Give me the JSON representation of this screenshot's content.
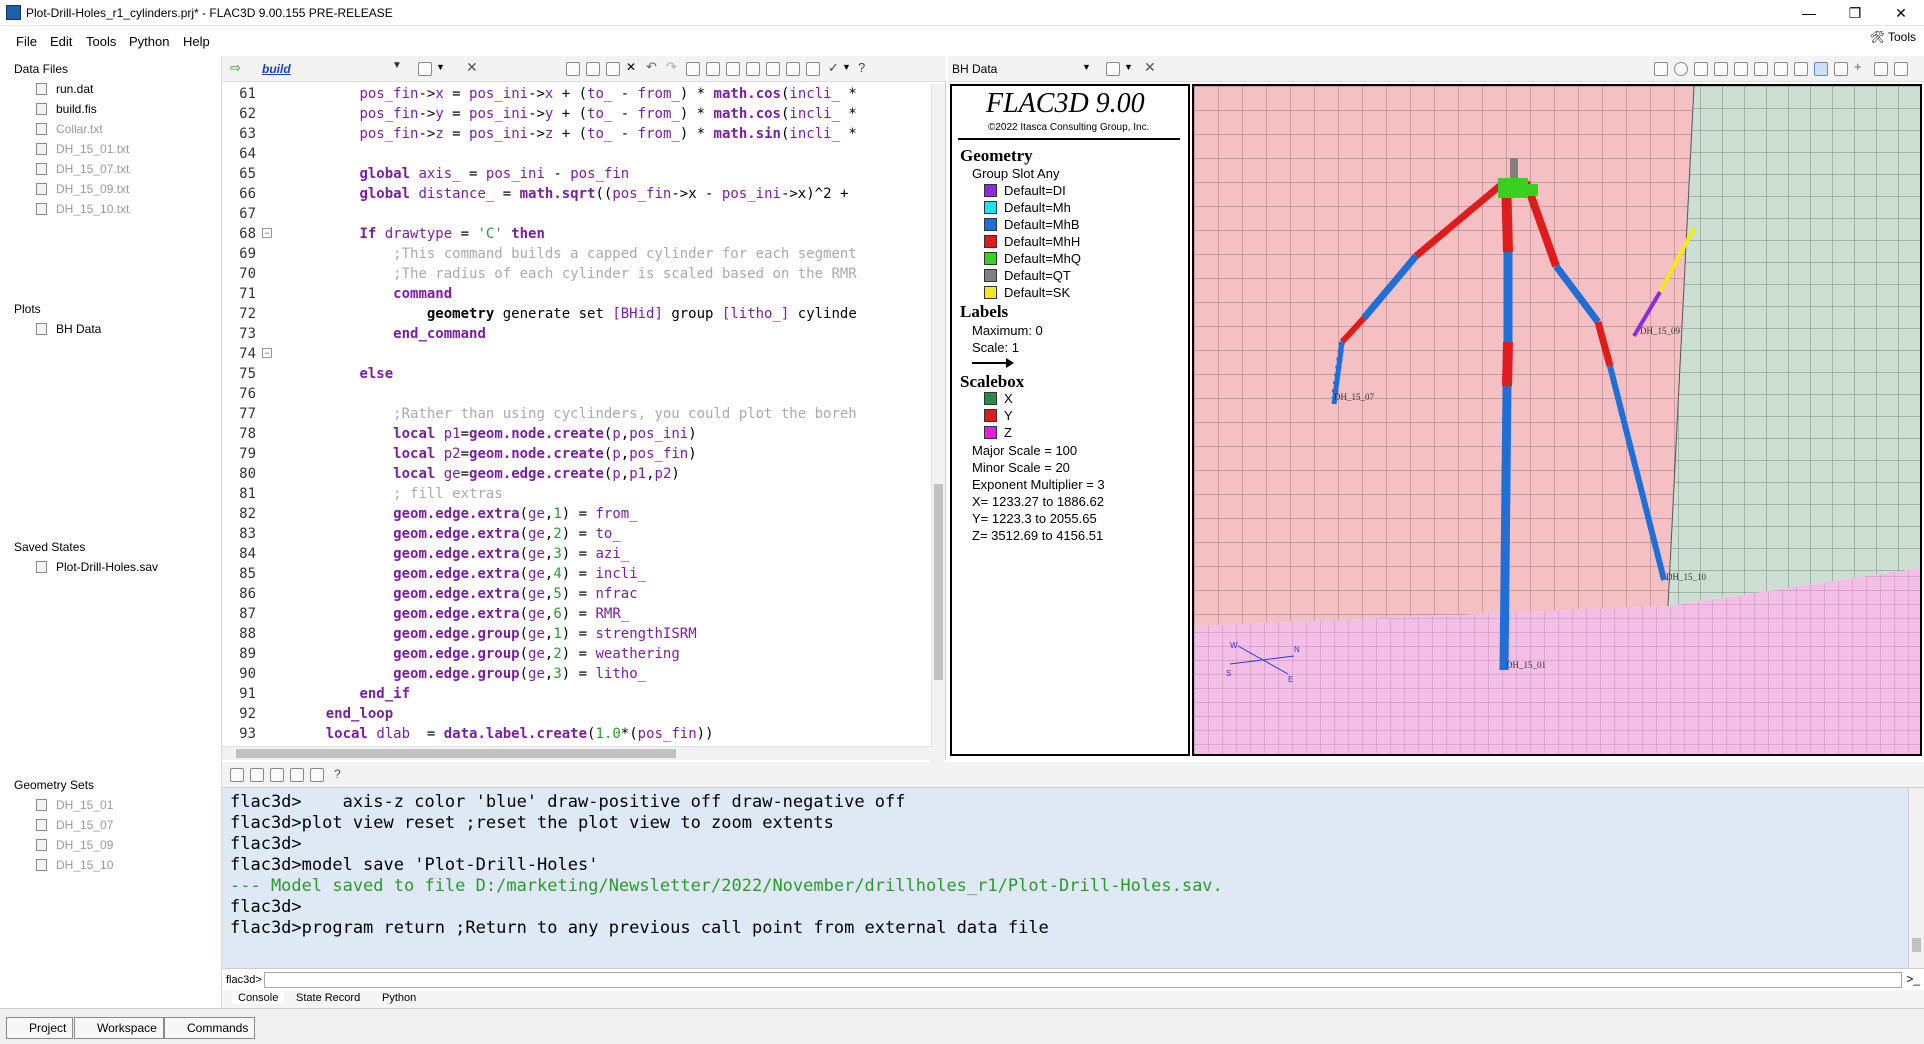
{
  "window": {
    "title": "Plot-Drill-Holes_r1_cylinders.prj* - FLAC3D 9.00.155 PRE-RELEASE",
    "minimize": "—",
    "maximize": "❐",
    "close": "✕"
  },
  "menu": {
    "file": "File",
    "edit": "Edit",
    "tools": "Tools",
    "python": "Python",
    "help": "Help",
    "tools_right": "Tools"
  },
  "left": {
    "data_files_title": "Data Files",
    "data_files": [
      "run.dat",
      "build.fis",
      "Collar.txt",
      "DH_15_01.txt",
      "DH_15_07.txt",
      "DH_15_09.txt",
      "DH_15_10.txt"
    ],
    "plots_title": "Plots",
    "plots": [
      "BH Data"
    ],
    "saved_title": "Saved States",
    "saved": [
      "Plot-Drill-Holes.sav"
    ],
    "geom_title": "Geometry Sets",
    "geom": [
      "DH_15_01",
      "DH_15_07",
      "DH_15_09",
      "DH_15_10"
    ]
  },
  "editor": {
    "tab": "build",
    "line_numbers": [
      "61",
      "62",
      "63",
      "64",
      "65",
      "66",
      "67",
      "68",
      "69",
      "70",
      "71",
      "72",
      "73",
      "74",
      "75",
      "76",
      "77",
      "78",
      "79",
      "80",
      "81",
      "82",
      "83",
      "84",
      "85",
      "86",
      "87",
      "88",
      "89",
      "90",
      "91",
      "92",
      "93"
    ]
  },
  "plot": {
    "tab": "BH Data"
  },
  "legend": {
    "title": "FLAC3D 9.00",
    "copyright": "©2022 Itasca Consulting Group, Inc.",
    "geometry_h": "Geometry",
    "group_slot": "Group Slot Any",
    "groups": [
      {
        "label": "Default=DI",
        "color": "#8a2be2"
      },
      {
        "label": "Default=Mh",
        "color": "#1ee0f0"
      },
      {
        "label": "Default=MhB",
        "color": "#1f6fd6"
      },
      {
        "label": "Default=MhH",
        "color": "#e01b1b"
      },
      {
        "label": "Default=MhQ",
        "color": "#39d11f"
      },
      {
        "label": "Default=QT",
        "color": "#808080"
      },
      {
        "label": "Default=SK",
        "color": "#f2e91a"
      }
    ],
    "labels_h": "Labels",
    "max": "Maximum: 0",
    "scale": "Scale: 1",
    "scalebox_h": "Scalebox",
    "axes": [
      {
        "label": "X",
        "color": "#2a8a4a"
      },
      {
        "label": "Y",
        "color": "#e01b1b"
      },
      {
        "label": "Z",
        "color": "#e81ce0"
      }
    ],
    "major": "Major Scale = 100",
    "minor": "Minor Scale = 20",
    "exp": "Exponent Multiplier = 3",
    "xr": "X= 1233.27 to 1886.62",
    "yr": "Y= 1223.3 to 2055.65",
    "zr": "Z= 3512.69 to 4156.51"
  },
  "viewport": {
    "dh_labels": [
      "DH_15_07",
      "DH_15_09",
      "DH_15_10",
      "DH_15_01"
    ],
    "compass": [
      "W",
      "N",
      "S",
      "E"
    ]
  },
  "console": {
    "lines": [
      {
        "t": "flac3d>    axis-z color 'blue' draw-positive off draw-negative off",
        "c": "#000"
      },
      {
        "t": "flac3d>plot view reset ;reset the plot view to zoom extents",
        "c": "#000"
      },
      {
        "t": "flac3d>",
        "c": "#000"
      },
      {
        "t": "flac3d>model save 'Plot-Drill-Holes'",
        "c": "#000"
      },
      {
        "t": "--- Model saved to file D:/marketing/Newsletter/2022/November/drillholes_r1/Plot-Drill-Holes.sav.",
        "c": "#2a9a2a"
      },
      {
        "t": "flac3d>",
        "c": "#000"
      },
      {
        "t": "flac3d>program return ;Return to any previous call point from external data file",
        "c": "#000"
      }
    ],
    "prompt": "flac3d>",
    "tabs": [
      "Console",
      "State Record",
      "Python"
    ]
  },
  "status": {
    "project": "Project",
    "workspace": "Workspace",
    "commands": "Commands"
  }
}
